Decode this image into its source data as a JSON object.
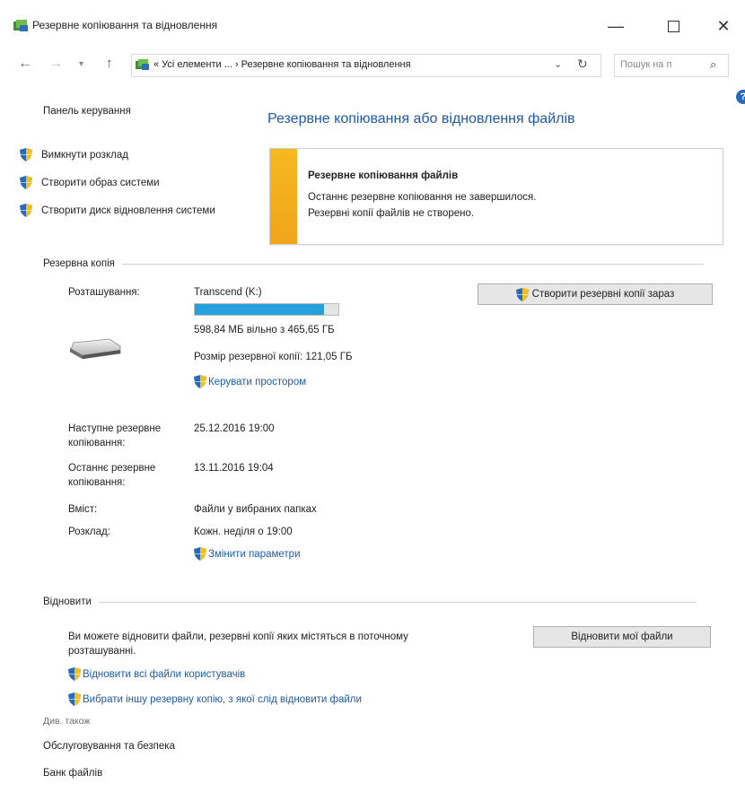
{
  "window": {
    "title": "Резервне копіювання та відновлення",
    "minimize_glyph": "—",
    "close_glyph": "✕"
  },
  "addressbar": {
    "back_glyph": "←",
    "forward_glyph": "→",
    "recent_glyph": "▾",
    "up_glyph": "↑",
    "path": "« Усі елементи ... › Резервне копіювання та відновлення",
    "dropdown_glyph": "⌄",
    "refresh_glyph": "↻",
    "search_placeholder": "Пошук на п",
    "search_glyph": "⌕"
  },
  "help_glyph": "?",
  "sidebar": {
    "home": "Панель керування",
    "tasks": [
      {
        "label": "Вимкнути розклад",
        "icon": "uac-shield-icon"
      },
      {
        "label": "Створити образ системи",
        "icon": "uac-shield-icon"
      },
      {
        "label": "Створити диск відновлення системи",
        "icon": "uac-shield-icon"
      }
    ],
    "see_also": "Див. також",
    "see_also_links": [
      "Обслуговування та безпека",
      "Банк файлів"
    ]
  },
  "main": {
    "heading": "Резервне копіювання або відновлення файлів",
    "warning": {
      "title": "Резервне копіювання файлів",
      "line1": "Останнє резервне копіювання не завершилося.",
      "line2": "Резервні копії файлів не створено.",
      "accent_color": "#f5b921"
    },
    "backup": {
      "section_title": "Резервна копія",
      "location_label": "Розташування:",
      "location_value": "Transcend (K:)",
      "disk_fill_fraction": 0.9,
      "free_space": "598,84 МБ вільно з 465,65 ГБ",
      "backup_size": "Розмір резервної копії: 121,05 ГБ",
      "manage_space_link": "Керувати простором",
      "backup_now_button": "Створити резервні копії зараз",
      "next_label": "Наступне резервне копіювання:",
      "next_value": "25.12.2016 19:00",
      "last_label": "Останнє резервне копіювання:",
      "last_value": "13.11.2016 19:04",
      "contents_label": "Вміст:",
      "contents_value": "Файли у вибраних папках",
      "schedule_label": "Розклад:",
      "schedule_value": "Кожн. неділя о 19:00",
      "change_settings_link": "Змінити параметри"
    },
    "restore": {
      "section_title": "Відновити",
      "description": "Ви можете відновити файли, резервні копії яких містяться в поточному розташуванні.",
      "restore_button": "Відновити мої файли",
      "restore_all_link": "Відновити всі файли користувачів",
      "select_other_link": "Вибрати іншу резервну копію, з якої слід відновити файли"
    }
  },
  "colors": {
    "link": "#1e5aa8",
    "progress": "#26a0da"
  }
}
